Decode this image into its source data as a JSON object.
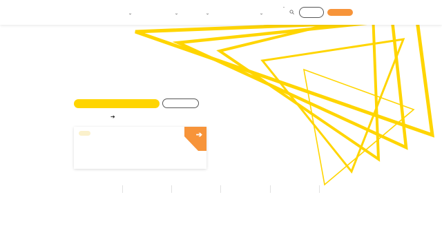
{
  "header": {
    "nav_items": [
      {
        "label": "",
        "icon": "chevron-down-icon"
      },
      {
        "label": "",
        "icon": "chevron-down-icon"
      },
      {
        "label": "",
        "icon": "chevron-down-icon"
      },
      {
        "label": "",
        "icon": "chevron-down-icon"
      }
    ],
    "lang_toggle_icon": "chevron-down-icon",
    "search_icon": "search-icon",
    "outline_button_label": "",
    "primary_button_label": ""
  },
  "hero": {
    "primary_cta_label": "",
    "secondary_cta_label": "",
    "link_label": "",
    "link_icon": "arrow-right-icon",
    "art_color": "#ffd500"
  },
  "promo_card": {
    "tag_label": "",
    "title": "",
    "corner_icon": "arrow-right-icon",
    "corner_color": "#f7943a"
  },
  "stats": {
    "items": [
      "",
      "",
      "",
      "",
      ""
    ]
  },
  "colors": {
    "accent_yellow": "#ffd500",
    "accent_orange": "#f7943a",
    "tag_bg": "#fbf1cc"
  }
}
